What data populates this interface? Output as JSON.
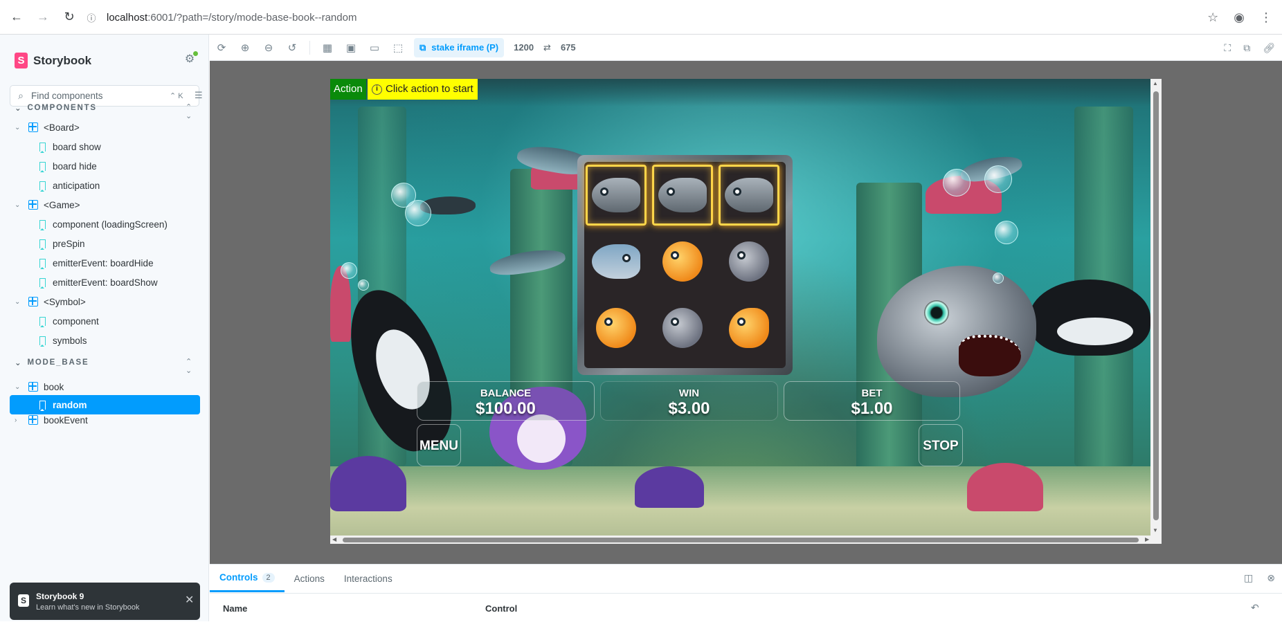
{
  "browser": {
    "url_host": "localhost",
    "url_path": ":6001/?path=/story/mode-base-book--random"
  },
  "sidebar": {
    "brand": "Storybook",
    "search_placeholder": "Find components",
    "search_shortcut": "⌃ K",
    "sections": [
      {
        "title": "COMPONENTS",
        "groups": [
          {
            "label": "<Board>",
            "stories": [
              "board show",
              "board hide",
              "anticipation"
            ]
          },
          {
            "label": "<Game>",
            "stories": [
              "component (loadingScreen)",
              "preSpin",
              "emitterEvent: boardHide",
              "emitterEvent: boardShow"
            ]
          },
          {
            "label": "<Symbol>",
            "stories": [
              "component",
              "symbols"
            ]
          }
        ]
      },
      {
        "title": "MODE_BASE",
        "groups": [
          {
            "label": "book",
            "stories": [
              "random"
            ]
          },
          {
            "label": "bookEvent",
            "stories": []
          }
        ]
      }
    ],
    "selected_story": "random",
    "notification": {
      "title": "Storybook 9",
      "subtitle": "Learn what's new in Storybook"
    }
  },
  "toolbar": {
    "viewport_label": "stake iframe (P)",
    "width": "1200",
    "swap": "⇄",
    "height": "675"
  },
  "game": {
    "action_tag": "Action",
    "action_hint": "Click action to start",
    "balance_label": "BALANCE",
    "balance_value": "$100.00",
    "win_label": "WIN",
    "win_value": "$3.00",
    "bet_label": "BET",
    "bet_value": "$1.00",
    "menu_label": "MENU",
    "stop_label": "STOP",
    "reels": [
      [
        "shark",
        "shark",
        "shark"
      ],
      [
        "blue-fish",
        "gold-fish",
        "grey-fish"
      ],
      [
        "gold-fish",
        "grey-fish",
        "gold-fish"
      ]
    ],
    "winning_row": 0
  },
  "panel": {
    "tabs": [
      {
        "label": "Controls",
        "badge": "2"
      },
      {
        "label": "Actions"
      },
      {
        "label": "Interactions"
      }
    ],
    "columns": [
      "Name",
      "Control"
    ]
  },
  "colors": {
    "accent": "#029cfd",
    "brand": "#ff4785",
    "action_green": "#0a8a0a",
    "hint_yellow": "#ffff00"
  }
}
